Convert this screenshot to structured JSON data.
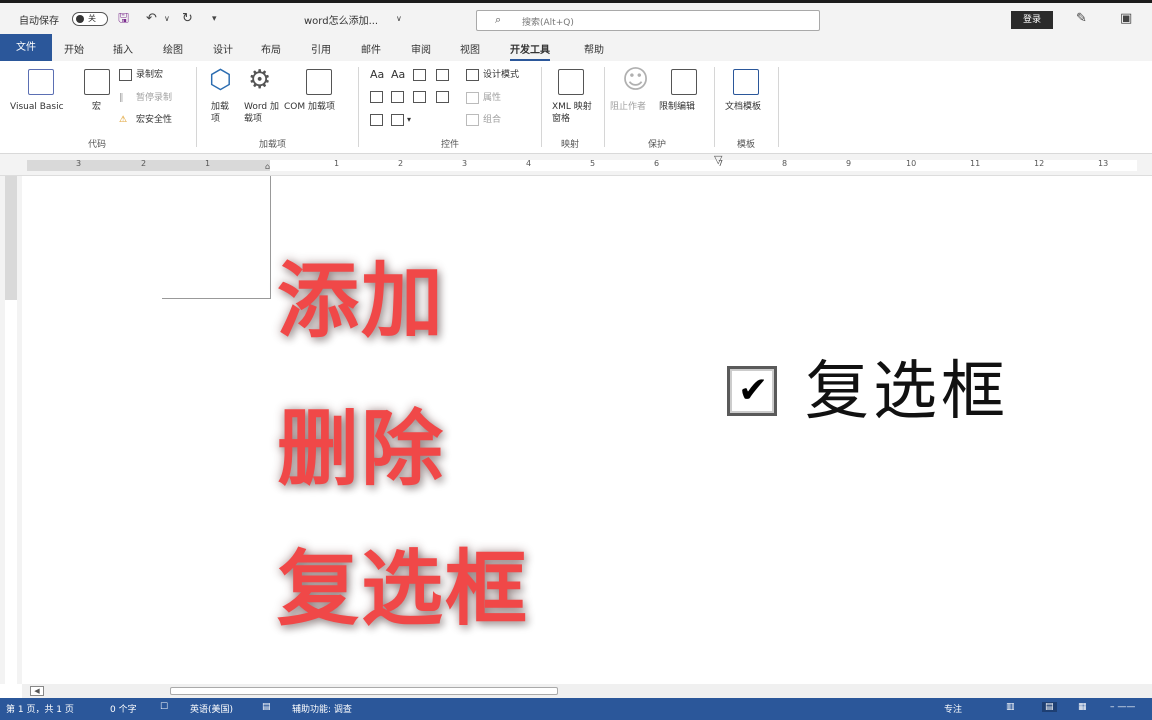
{
  "titlebar": {
    "autosave_label": "自动保存",
    "autosave_state": "关",
    "doc_title": "word怎么添加...",
    "search_placeholder": "搜索(Alt+Q)",
    "login_label": "登录"
  },
  "tabs": [
    "文件",
    "开始",
    "插入",
    "绘图",
    "设计",
    "布局",
    "引用",
    "邮件",
    "审阅",
    "视图",
    "开发工具",
    "帮助"
  ],
  "ribbon": {
    "code": {
      "visual_basic": "Visual Basic",
      "macros": "宏",
      "record_macro": "录制宏",
      "pause_recording": "暂停录制",
      "macro_security": "宏安全性",
      "group_label": "代码"
    },
    "addins": {
      "addins": "加载项",
      "word_addins": "Word 加载项",
      "com_addins": "COM 加载项",
      "group_label": "加载项"
    },
    "controls": {
      "design_mode": "设计模式",
      "properties": "属性",
      "group": "组合",
      "group_label": "控件"
    },
    "mapping": {
      "xml_pane": "XML 映射窗格",
      "group_label": "映射"
    },
    "protect": {
      "block_authors": "阻止作者",
      "restrict_editing": "限制编辑",
      "group_label": "保护"
    },
    "templates": {
      "document_template": "文档模板",
      "group_label": "模板"
    }
  },
  "ruler_numbers": [
    "3",
    "2",
    "1",
    "1",
    "2",
    "3",
    "4",
    "5",
    "6",
    "7",
    "8",
    "9",
    "10",
    "11",
    "12",
    "13"
  ],
  "document": {
    "overlay_lines": [
      "添加",
      "删除",
      "复选框"
    ],
    "checkbox_checked": true,
    "checkbox_label": "复选框"
  },
  "statusbar": {
    "page": "第 1 页，共 1 页",
    "words": "0 个字",
    "language": "英语(美国)",
    "accessibility": "辅助功能: 调查",
    "focus": "专注"
  }
}
